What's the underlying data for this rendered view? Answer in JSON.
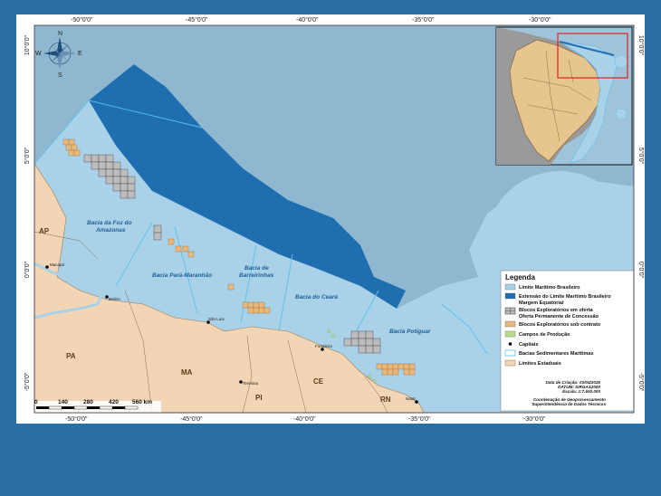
{
  "coordinates": {
    "top": [
      "-50°0'0\"",
      "-45°0'0\"",
      "-40°0'0\"",
      "-35°0'0\"",
      "-30°0'0\""
    ],
    "bottom": [
      "-50°0'0\"",
      "-45°0'0\"",
      "-40°0'0\"",
      "-35°0'0\"",
      "-30°0'0\""
    ],
    "left": [
      "10°0'0\"",
      "5°0'0\"",
      "0°0'0\"",
      "-5°0'0\""
    ],
    "right": [
      "10°0'0\"",
      "5°0'0\"",
      "0°0'0\"",
      "-5°0'0\""
    ]
  },
  "compass": {
    "north": "N",
    "south": "S",
    "east": "E",
    "west": "W"
  },
  "basins": [
    {
      "line1": "Bacia da Foz do",
      "line2": "Amazonas"
    },
    {
      "line1": "Bacia Pará-Maranhão",
      "line2": ""
    },
    {
      "line1": "Bacia de",
      "line2": "Barreirinhas"
    },
    {
      "line1": "Bacia do Ceará",
      "line2": ""
    },
    {
      "line1": "Bacia Potiguar",
      "line2": ""
    }
  ],
  "states": [
    "AP",
    "PA",
    "MA",
    "PI",
    "CE",
    "RN"
  ],
  "capitals": [
    "Macapá",
    "Belém",
    "São Luís",
    "Teresina",
    "Fortaleza",
    "Natal"
  ],
  "legend": {
    "title": "Legenda",
    "items": [
      {
        "label": "Limite Marítimo Brasileiro",
        "label2": "",
        "color": "#a9d1e8",
        "icon": "swatch"
      },
      {
        "label": "Extensão do Limite Marítimo Brasileiro",
        "label2": "Margem Equatorial",
        "color": "#1f6fb0",
        "icon": "swatch"
      },
      {
        "label": "Blocos Exploratórios em oferta",
        "label2": "Oferta Permanente de Concessão",
        "color": "#bdbdbd",
        "icon": "grid"
      },
      {
        "label": "Blocos Exploratórios sob contrato",
        "label2": "",
        "color": "#e8b97a",
        "icon": "swatch"
      },
      {
        "label": "Campos de Produção",
        "label2": "",
        "color": "#b8e08a",
        "icon": "swatch"
      },
      {
        "label": "Capitais",
        "label2": "",
        "color": "#000000",
        "icon": "dot"
      },
      {
        "label": "Bacias Sedimentares Marítimas",
        "label2": "",
        "color": "#5bc0eb",
        "icon": "outline"
      },
      {
        "label": "Limites Estaduais",
        "label2": "",
        "color": "#f2d5b4",
        "icon": "swatch"
      }
    ]
  },
  "credits": {
    "date": "Data de Criação: 03/04/2025",
    "datum": "DATUM: SIRGAS2000",
    "scale": "Escala: 1:7.600.000",
    "org1": "Coordenação de Geoprocessamento",
    "org2": "Superintendência de Dados Técnicos"
  },
  "scalebar": {
    "ticks": [
      "0",
      "140",
      "280",
      "420",
      "560 km"
    ]
  },
  "colors": {
    "ocean": "#8fb8d0",
    "limit": "#a9d1e8",
    "extension": "#1f6fb0",
    "land": "#f2d5b4",
    "offered": "#bdbdbd",
    "contract": "#e8b97a",
    "fields": "#b8e08a",
    "inset_highlight": "#e02020"
  }
}
